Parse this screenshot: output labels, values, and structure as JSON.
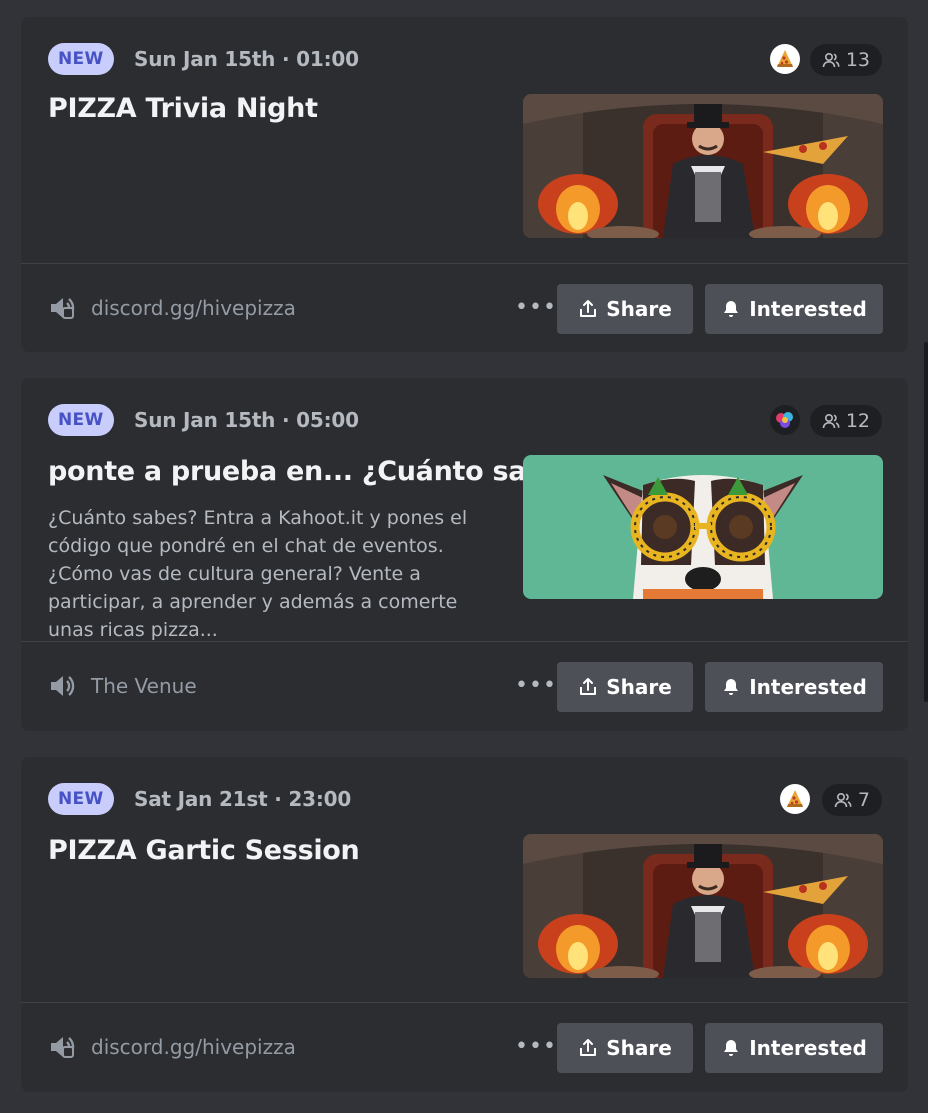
{
  "events": [
    {
      "badge": "NEW",
      "date": "Sun Jan 15th · 01:00",
      "title": "PIZZA Trivia Night",
      "description": "",
      "interested_count": "13",
      "location": "discord.gg/hivepizza",
      "location_icon": "external-link-speaker-icon",
      "thumbnail": "pizza-chef-throne",
      "avatar": "pizza-avatar",
      "share_label": "Share",
      "interested_label": "Interested"
    },
    {
      "badge": "NEW",
      "date": "Sun Jan 15th · 05:00",
      "title": "ponte a prueba en... ¿Cuánto sa...",
      "description": "¿Cuánto sabes? Entra a Kahoot.it y pones el código que pondré en el chat de eventos. ¿Cómo vas de cultura general? Vente a participar, a aprender y además a comerte unas ricas pizza...",
      "interested_count": "12",
      "location": "The Venue",
      "location_icon": "stage-speaker-icon",
      "thumbnail": "dog-pineapple-glasses",
      "avatar": "colorful-avatar",
      "share_label": "Share",
      "interested_label": "Interested"
    },
    {
      "badge": "NEW",
      "date": "Sat Jan 21st · 23:00",
      "title": "PIZZA Gartic Session",
      "description": "",
      "interested_count": "7",
      "location": "discord.gg/hivepizza",
      "location_icon": "external-link-speaker-icon",
      "thumbnail": "pizza-chef-throne",
      "avatar": "pizza-avatar",
      "share_label": "Share",
      "interested_label": "Interested"
    }
  ],
  "colors": {
    "background": "#313338",
    "card": "#2b2d31",
    "badge_bg": "#c9cdfb",
    "badge_text": "#4752c4",
    "button": "#4e5058"
  }
}
